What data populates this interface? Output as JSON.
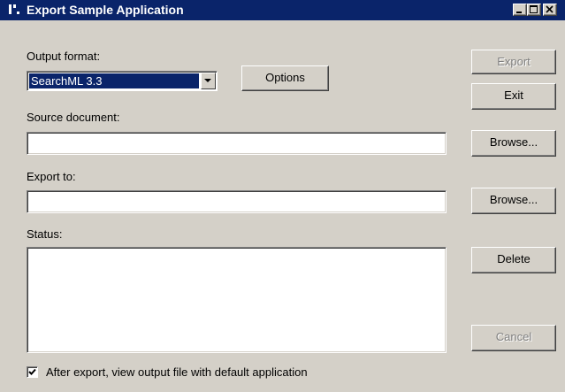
{
  "window": {
    "title": "Export Sample Application",
    "icon": "app-icon"
  },
  "title_buttons": {
    "minimize_icon": "minimize-icon",
    "maximize_icon": "maximize-icon",
    "close_icon": "close-icon"
  },
  "output_format": {
    "label": "Output format:",
    "selected": "SearchML 3.3",
    "options_button": "Options"
  },
  "source_document": {
    "label": "Source document:",
    "value": "",
    "browse_button": "Browse..."
  },
  "export_to": {
    "label": "Export to:",
    "value": "",
    "browse_button": "Browse..."
  },
  "status": {
    "label": "Status:",
    "value": ""
  },
  "buttons": {
    "export": "Export",
    "exit": "Exit",
    "delete": "Delete",
    "cancel": "Cancel"
  },
  "view_after_export": {
    "label": "After export, view output file with default application",
    "checked": true
  },
  "colors": {
    "title_bar": "#0a246a",
    "dialog_bg": "#d4d0c8",
    "selection": "#0a246a"
  }
}
